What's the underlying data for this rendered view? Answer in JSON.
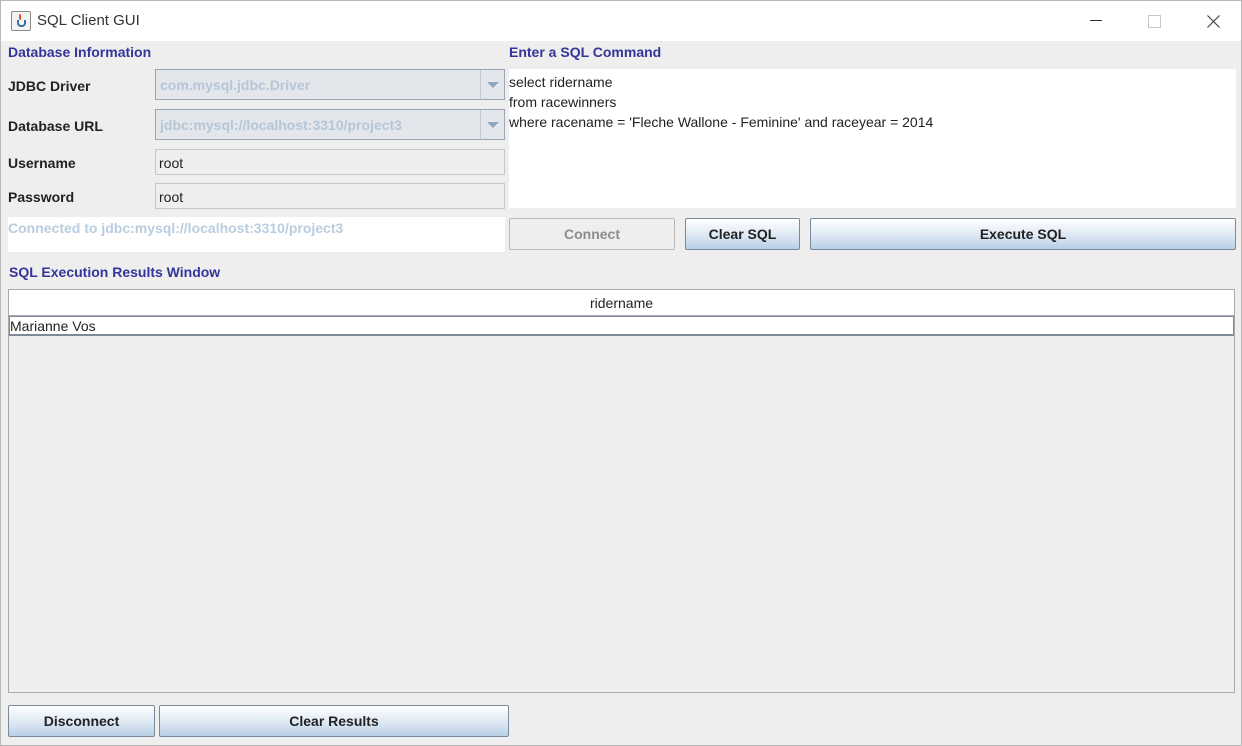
{
  "window": {
    "title": "SQL Client GUI"
  },
  "db_info": {
    "section_title": "Database Information",
    "jdbc_label": "JDBC Driver",
    "jdbc_value": "com.mysql.jdbc.Driver",
    "url_label": "Database URL",
    "url_value": "jdbc:mysql://localhost:3310/project3",
    "username_label": "Username",
    "username_value": "root",
    "password_label": "Password",
    "password_value": "root",
    "status_text": "Connected to jdbc:mysql://localhost:3310/project3"
  },
  "sql": {
    "section_title": "Enter a SQL Command",
    "lines": [
      "select ridername",
      "from racewinners",
      "where racename = 'Fleche Wallone - Feminine' and raceyear = 2014"
    ]
  },
  "buttons": {
    "connect": "Connect",
    "clear_sql": "Clear SQL",
    "execute_sql": "Execute SQL",
    "disconnect": "Disconnect",
    "clear_results": "Clear Results"
  },
  "results": {
    "section_title": "SQL Execution Results Window",
    "columns": [
      "ridername"
    ],
    "rows": [
      [
        "Marianne Vos"
      ]
    ]
  },
  "colors": {
    "section_title": "#343499",
    "disabled_text": "#b8cde0"
  }
}
